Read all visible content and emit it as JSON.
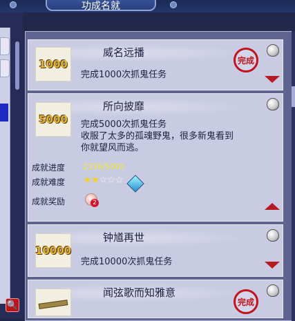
{
  "header": {
    "title": "功成名就"
  },
  "left_buttons": [
    "",
    ""
  ],
  "search_icon": "🔍",
  "achievements": [
    {
      "badge": "1000",
      "title": "威名远播",
      "desc": "完成1000次抓鬼任务",
      "seal": "完成"
    },
    {
      "badge": "5000",
      "title": "所向披靡",
      "desc": "完成5000次抓鬼任务",
      "extra": "收服了太多的孤魂野鬼，很多新鬼看到你就望风而逃。",
      "progress_label": "成就进度",
      "progress_value": "2336/5000",
      "difficulty_label": "成就难度",
      "difficulty_stars": 2,
      "difficulty_max": 5,
      "reward_label": "成就奖励",
      "reward_count": "2"
    },
    {
      "badge": "10000",
      "title": "钟馗再世",
      "desc": "完成10000次抓鬼任务"
    },
    {
      "title": "闻弦歌而知雅意",
      "seal": "完成"
    }
  ],
  "colors": {
    "seal_red": "#c1121c",
    "progress_yellow": "#f5ea2a"
  }
}
